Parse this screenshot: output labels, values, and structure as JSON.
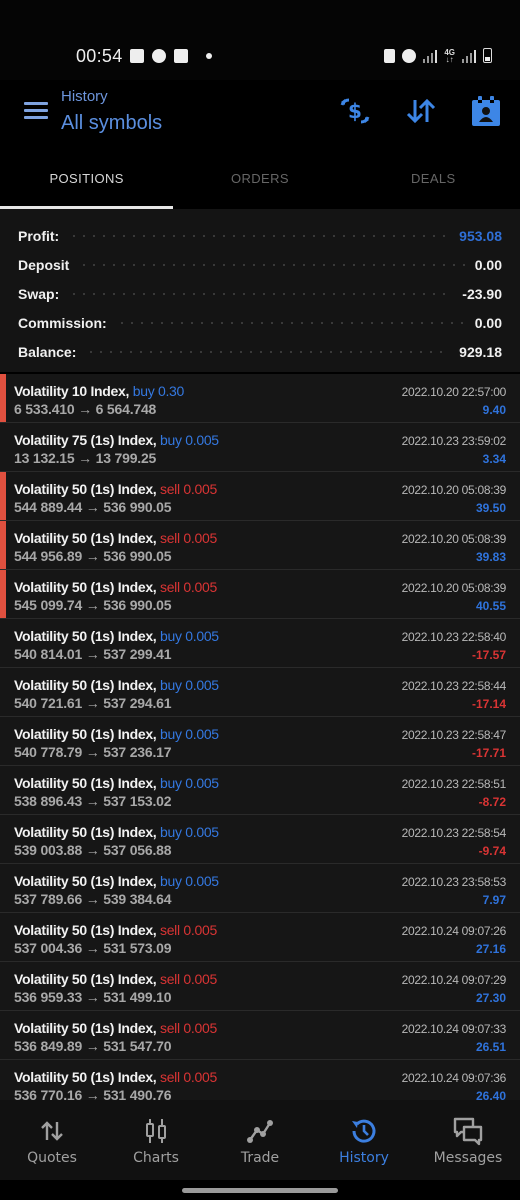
{
  "status_bar": {
    "time": "00:54",
    "left_icons": [
      "gallery-icon",
      "upload-icon",
      "camera-icon",
      "dot-icon"
    ],
    "right_icons": [
      "battery-saver-icon",
      "alarm-icon",
      "signal-icon",
      "network-4g-icon",
      "signal-icon",
      "battery-icon"
    ],
    "network": "4G"
  },
  "header": {
    "subtitle": "History",
    "title": "All symbols",
    "actions": [
      "currency-exchange-icon",
      "sort-icon",
      "calendar-icon"
    ]
  },
  "tabs": [
    {
      "label": "POSITIONS",
      "active": true
    },
    {
      "label": "ORDERS",
      "active": false
    },
    {
      "label": "DEALS",
      "active": false
    }
  ],
  "summary": {
    "profit": {
      "label": "Profit:",
      "value": "953.08"
    },
    "deposit": {
      "label": "Deposit",
      "value": "0.00"
    },
    "swap": {
      "label": "Swap:",
      "value": "-23.90"
    },
    "commission": {
      "label": "Commission:",
      "value": "0.00"
    },
    "balance": {
      "label": "Balance:",
      "value": "929.18"
    }
  },
  "positions": [
    {
      "symbol": "Volatility 10 Index,",
      "side": "buy",
      "side_text": "buy 0.30",
      "prices": "6 533.410 → 6 564.748",
      "time": "2022.10.20 22:57:00",
      "profit": "9.40",
      "marked": true
    },
    {
      "symbol": "Volatility 75 (1s) Index,",
      "side": "buy",
      "side_text": "buy 0.005",
      "prices": "13 132.15 → 13 799.25",
      "time": "2022.10.23 23:59:02",
      "profit": "3.34",
      "marked": false
    },
    {
      "symbol": "Volatility 50 (1s) Index,",
      "side": "sell",
      "side_text": "sell 0.005",
      "prices": "544 889.44 → 536 990.05",
      "time": "2022.10.20 05:08:39",
      "profit": "39.50",
      "marked": true
    },
    {
      "symbol": "Volatility 50 (1s) Index,",
      "side": "sell",
      "side_text": "sell 0.005",
      "prices": "544 956.89 → 536 990.05",
      "time": "2022.10.20 05:08:39",
      "profit": "39.83",
      "marked": true
    },
    {
      "symbol": "Volatility 50 (1s) Index,",
      "side": "sell",
      "side_text": "sell 0.005",
      "prices": "545 099.74 → 536 990.05",
      "time": "2022.10.20 05:08:39",
      "profit": "40.55",
      "marked": true
    },
    {
      "symbol": "Volatility 50 (1s) Index,",
      "side": "buy",
      "side_text": "buy 0.005",
      "prices": "540 814.01 → 537 299.41",
      "time": "2022.10.23 22:58:40",
      "profit": "-17.57",
      "marked": false
    },
    {
      "symbol": "Volatility 50 (1s) Index,",
      "side": "buy",
      "side_text": "buy 0.005",
      "prices": "540 721.61 → 537 294.61",
      "time": "2022.10.23 22:58:44",
      "profit": "-17.14",
      "marked": false
    },
    {
      "symbol": "Volatility 50 (1s) Index,",
      "side": "buy",
      "side_text": "buy 0.005",
      "prices": "540 778.79 → 537 236.17",
      "time": "2022.10.23 22:58:47",
      "profit": "-17.71",
      "marked": false
    },
    {
      "symbol": "Volatility 50 (1s) Index,",
      "side": "buy",
      "side_text": "buy 0.005",
      "prices": "538 896.43 → 537 153.02",
      "time": "2022.10.23 22:58:51",
      "profit": "-8.72",
      "marked": false
    },
    {
      "symbol": "Volatility 50 (1s) Index,",
      "side": "buy",
      "side_text": "buy 0.005",
      "prices": "539 003.88 → 537 056.88",
      "time": "2022.10.23 22:58:54",
      "profit": "-9.74",
      "marked": false
    },
    {
      "symbol": "Volatility 50 (1s) Index,",
      "side": "buy",
      "side_text": "buy 0.005",
      "prices": "537 789.66 → 539 384.64",
      "time": "2022.10.23 23:58:53",
      "profit": "7.97",
      "marked": false
    },
    {
      "symbol": "Volatility 50 (1s) Index,",
      "side": "sell",
      "side_text": "sell 0.005",
      "prices": "537 004.36 → 531 573.09",
      "time": "2022.10.24 09:07:26",
      "profit": "27.16",
      "marked": false
    },
    {
      "symbol": "Volatility 50 (1s) Index,",
      "side": "sell",
      "side_text": "sell 0.005",
      "prices": "536 959.33 → 531 499.10",
      "time": "2022.10.24 09:07:29",
      "profit": "27.30",
      "marked": false
    },
    {
      "symbol": "Volatility 50 (1s) Index,",
      "side": "sell",
      "side_text": "sell 0.005",
      "prices": "536 849.89 → 531 547.70",
      "time": "2022.10.24 09:07:33",
      "profit": "26.51",
      "marked": false
    },
    {
      "symbol": "Volatility 50 (1s) Index,",
      "side": "sell",
      "side_text": "sell 0.005",
      "prices": "536 770.16 → 531 490.76",
      "time": "2022.10.24 09:07:36",
      "profit": "26.40",
      "marked": false
    }
  ],
  "bottom_nav": [
    {
      "label": "Quotes",
      "icon": "quotes-icon",
      "active": false
    },
    {
      "label": "Charts",
      "icon": "charts-icon",
      "active": false
    },
    {
      "label": "Trade",
      "icon": "trade-icon",
      "active": false
    },
    {
      "label": "History",
      "icon": "history-icon",
      "active": true
    },
    {
      "label": "Messages",
      "icon": "messages-icon",
      "active": false
    }
  ],
  "colors": {
    "accent": "#3c7fe0",
    "buy": "#3478e0",
    "sell": "#d93434",
    "profit_positive": "#2f73dc",
    "profit_negative": "#d93434",
    "marker": "#e0503f"
  }
}
